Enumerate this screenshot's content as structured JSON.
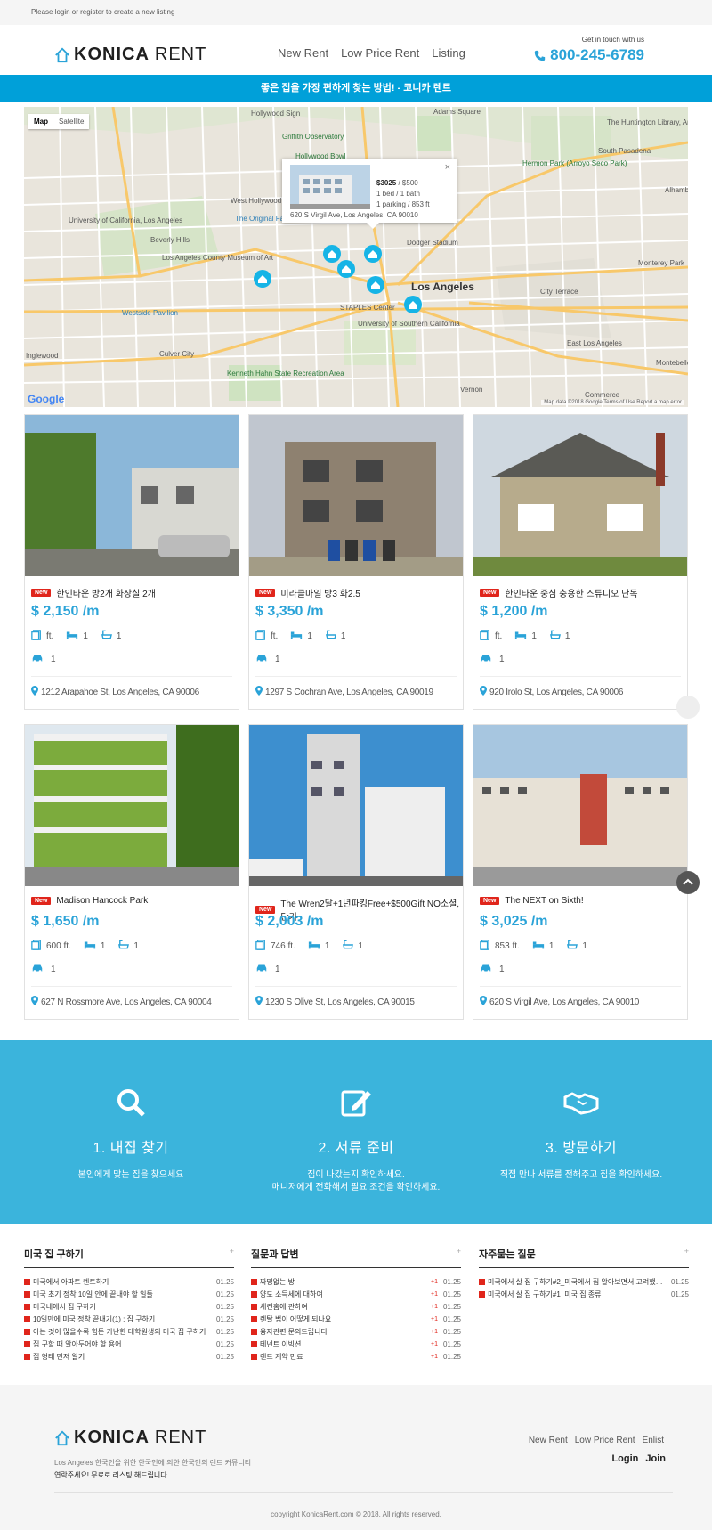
{
  "topbar": {
    "text": "Please login or register to create a new listing"
  },
  "brand": {
    "bold": "KONICA",
    "light": "RENT",
    "accent": "#2aa3d8"
  },
  "nav": {
    "items": [
      "New Rent",
      "Low Price Rent",
      "Listing"
    ]
  },
  "contact": {
    "label": "Get in touch with us",
    "phone": "800-245-6789"
  },
  "banner": {
    "text": "좋은 집을 가장 편하게 찾는 방법! - 코니카 렌트",
    "color": "#00a0d9"
  },
  "map": {
    "tabs": [
      "Map",
      "Satellite"
    ],
    "labels": [
      "Hollywood Sign",
      "Griffith Observatory",
      "Hollywood Bowl",
      "West Hollywood",
      "University of California, Los Angeles",
      "Beverly Hills",
      "The Original Farmers Market",
      "Los Angeles County Museum of Art",
      "Westside Pavilion",
      "Culver City",
      "Dodger Stadium",
      "Los Angeles",
      "STAPLES Center",
      "University of Southern California",
      "Kenneth Hahn State Recreation Area",
      "The Huntington Library, Art Collections, and...",
      "South Pasadena",
      "Alhambra",
      "Monterey Park",
      "City Terrace",
      "East Los Angeles",
      "Montebello",
      "Commerce",
      "Vernon",
      "Hermon Park (Arroyo Seco Park)",
      "Adams Square",
      "Inglewood"
    ],
    "infobox": {
      "price": "$3025",
      "suffix": "/ $500",
      "line1": "1 bed / 1 bath",
      "line2": "1 parking / 853 ft",
      "address": "620 S Virgil Ave, Los Angeles, CA 90010",
      "close": "×"
    },
    "google": "Google",
    "copyright": "Map data ©2018 Google   Terms of Use   Report a map error"
  },
  "listings": [
    {
      "badge": "New",
      "title": "한인타운 방2개 화장실 2개",
      "price": "$ 2,150 /m",
      "sqft": "ft.",
      "beds": "1",
      "baths": "1",
      "parking": "1",
      "address": "1212 Arapahoe St, Los Angeles, CA 90006"
    },
    {
      "badge": "New",
      "title": "미라클마일 방3 화2.5",
      "price": "$ 3,350 /m",
      "sqft": "ft.",
      "beds": "1",
      "baths": "1",
      "parking": "1",
      "address": "1297 S Cochran Ave, Los Angeles, CA 90019"
    },
    {
      "badge": "New",
      "title": "한인타운 중심 충용한 스튜디오 단독",
      "price": "$ 1,200 /m",
      "sqft": "ft.",
      "beds": "1",
      "baths": "1",
      "parking": "1",
      "address": "920 Irolo St, Los Angeles, CA 90006"
    },
    {
      "badge": "New",
      "title": "Madison Hancock Park",
      "price": "$ 1,650 /m",
      "sqft": "600 ft.",
      "beds": "1",
      "baths": "1",
      "parking": "1",
      "address": "627 N Rossmore Ave, Los Angeles, CA 90004"
    },
    {
      "badge": "New",
      "title": "The Wren2달+1년파킹Free+$500Gift NO소셜,단기",
      "price": "$ 2,003 /m",
      "sqft": "746 ft.",
      "beds": "1",
      "baths": "1",
      "parking": "1",
      "address": "1230 S Olive St, Los Angeles, CA 90015"
    },
    {
      "badge": "New",
      "title": "The NEXT on Sixth!",
      "price": "$ 3,025 /m",
      "sqft": "853 ft.",
      "beds": "1",
      "baths": "1",
      "parking": "1",
      "address": "620 S Virgil Ave, Los Angeles, CA 90010"
    }
  ],
  "steps": [
    {
      "icon": "search-icon",
      "title": "1. 내집 찾기",
      "desc1": "본인에게 맞는 집을 찾으세요",
      "desc2": ""
    },
    {
      "icon": "edit-icon",
      "title": "2. 서류 준비",
      "desc1": "집이 나갔는지 확인하세요.",
      "desc2": "매니저에게 전화해서 필요 조건을 확인하세요."
    },
    {
      "icon": "handshake-icon",
      "title": "3. 방문하기",
      "desc1": "직접 만나 서류를 전해주고 집을 확인하세요.",
      "desc2": ""
    }
  ],
  "boards": [
    {
      "title": "미국 집 구하기",
      "plus": "+",
      "items": [
        {
          "t": "미국에서 아파트 렌트하기",
          "c": "",
          "d": "01.25"
        },
        {
          "t": "미국 초기 정착 10일 안에 끝내야 할 일들",
          "c": "",
          "d": "01.25"
        },
        {
          "t": "미국내에서 집 구하기",
          "c": "",
          "d": "01.25"
        },
        {
          "t": "10일만에 미국 정착 끝내기(1) : 집 구하기",
          "c": "",
          "d": "01.25"
        },
        {
          "t": "아는 것이 많을수록 힘든 가난한 대학원생의 미국 집 구하기",
          "c": "",
          "d": "01.25"
        },
        {
          "t": "집 구할 때 알아두어야 할 용어",
          "c": "",
          "d": "01.25"
        },
        {
          "t": "집 형태 먼저 알기",
          "c": "",
          "d": "01.25"
        }
      ]
    },
    {
      "title": "질문과 답변",
      "plus": "+",
      "items": [
        {
          "t": "짜밍없는 방",
          "c": "+1",
          "d": "01.25"
        },
        {
          "t": "양도 소득세에 대하여",
          "c": "+1",
          "d": "01.25"
        },
        {
          "t": "세컨홈에 관하여",
          "c": "+1",
          "d": "01.25"
        },
        {
          "t": "렌탈 법이 어떻게 되나요",
          "c": "+1",
          "d": "01.25"
        },
        {
          "t": "융자관련 문의드립니다",
          "c": "+1",
          "d": "01.25"
        },
        {
          "t": "테넌트 이빅션",
          "c": "+1",
          "d": "01.25"
        },
        {
          "t": "렌트 계약 만료",
          "c": "+1",
          "d": "01.25"
        }
      ]
    },
    {
      "title": "자주묻는 질문",
      "plus": "+",
      "items": [
        {
          "t": "미국에서 살 집 구하기#2_미국에서 집 알아보면서 고려했던 6가지",
          "c": "",
          "d": "01.25"
        },
        {
          "t": "미국에서 살 집 구하기#1_미국 집 종류",
          "c": "",
          "d": "01.25"
        }
      ]
    }
  ],
  "footer": {
    "desc": "Los Angeles 한국인을 위한 한국인에 의한 한국인의 렌트 커뮤니티",
    "cta": "연락주세요! 무료로 리스팅 해드립니다.",
    "links": [
      "New Rent",
      "Low Price Rent",
      "Enlist"
    ],
    "auth": [
      "Login",
      "Join"
    ],
    "copyright": "copyright KonicaRent.com © 2018. All rights reserved."
  }
}
